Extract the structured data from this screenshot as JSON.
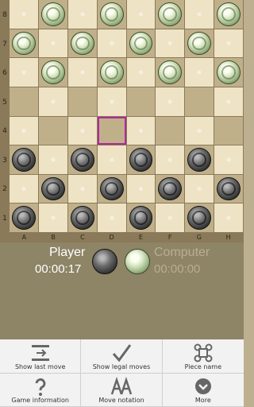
{
  "board": {
    "ranks": [
      "8",
      "7",
      "6",
      "5",
      "4",
      "3",
      "2",
      "1"
    ],
    "files": [
      "A",
      "B",
      "C",
      "D",
      "E",
      "F",
      "G",
      "H"
    ],
    "highlight": "D4",
    "pieces": {
      "white": [
        "B8",
        "D8",
        "F8",
        "H8",
        "A7",
        "C7",
        "E7",
        "G7",
        "B6",
        "D6",
        "F6",
        "H6"
      ],
      "black": [
        "A3",
        "C3",
        "E3",
        "G3",
        "B2",
        "D2",
        "F2",
        "H2",
        "A1",
        "C1",
        "E1",
        "G1"
      ]
    }
  },
  "status": {
    "player_label": "Player",
    "player_time": "00:00:17",
    "computer_label": "Computer",
    "computer_time": "00:00:00"
  },
  "menu": {
    "items": [
      {
        "label": "Show last move",
        "icon": "last-move-icon"
      },
      {
        "label": "Show legal moves",
        "icon": "checkmark-icon"
      },
      {
        "label": "Piece name",
        "icon": "command-icon"
      },
      {
        "label": "Game information",
        "icon": "question-icon"
      },
      {
        "label": "Move notation",
        "icon": "notation-icon"
      },
      {
        "label": "More",
        "icon": "more-icon"
      }
    ]
  }
}
